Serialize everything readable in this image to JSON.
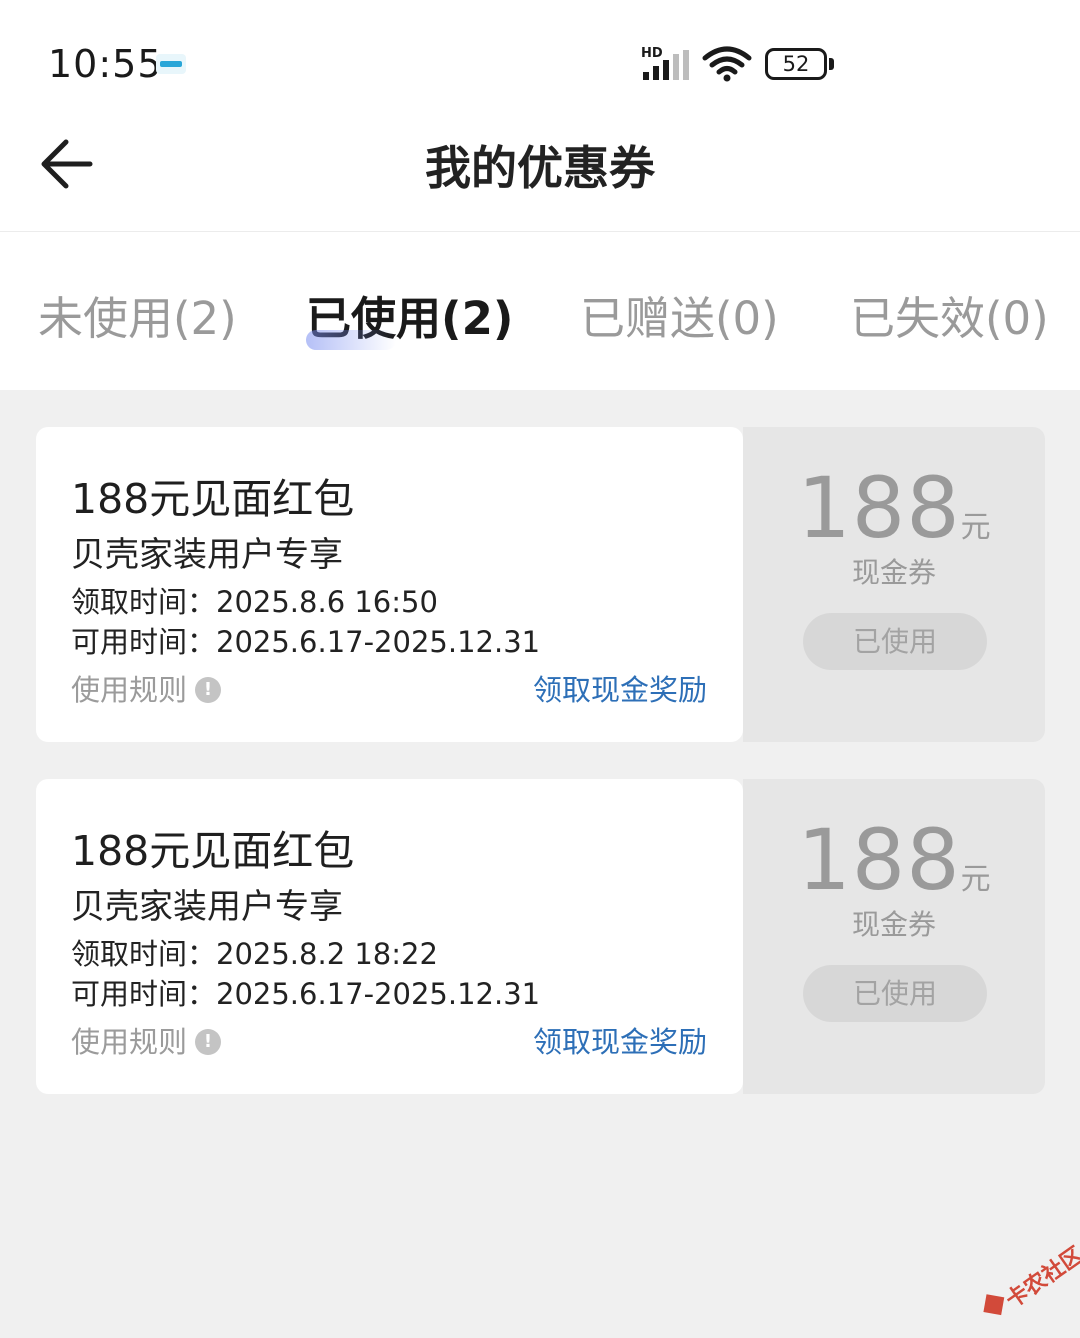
{
  "status_bar": {
    "time": "10:55",
    "network_label": "HD",
    "battery": "52"
  },
  "header": {
    "title": "我的优惠券"
  },
  "tabs": [
    {
      "label": "未使用(2)",
      "active": false
    },
    {
      "label": "已使用(2)",
      "active": true
    },
    {
      "label": "已赠送(0)",
      "active": false
    },
    {
      "label": "已失效(0)",
      "active": false
    }
  ],
  "coupons": [
    {
      "title": "188元见面红包",
      "subtitle": "贝壳家装用户专享",
      "received": "领取时间：2025.8.6 16:50",
      "valid": "可用时间：2025.6.17-2025.12.31",
      "rules_label": "使用规则",
      "reward_link": "领取现金奖励",
      "amount": "188",
      "unit": "元",
      "kind": "现金券",
      "status": "已使用"
    },
    {
      "title": "188元见面红包",
      "subtitle": "贝壳家装用户专享",
      "received": "领取时间：2025.8.2 18:22",
      "valid": "可用时间：2025.6.17-2025.12.31",
      "rules_label": "使用规则",
      "reward_link": "领取现金奖励",
      "amount": "188",
      "unit": "元",
      "kind": "现金券",
      "status": "已使用"
    }
  ],
  "watermark": "卡农社区",
  "colors": {
    "link": "#2d6fb7",
    "muted": "#9a9a9a",
    "background": "#f0f0f0"
  }
}
